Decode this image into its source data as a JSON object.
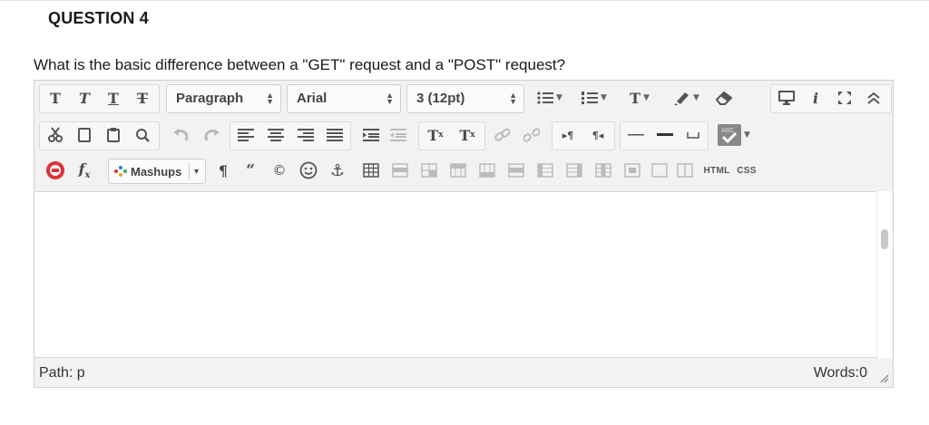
{
  "question": {
    "title": "QUESTION 4",
    "text": "What is the basic difference between a \"GET\" request and a \"POST\" request?"
  },
  "toolbar": {
    "paragraph_select": "Paragraph",
    "font_select": "Arial",
    "size_select": "3 (12pt)",
    "mashups_label": "Mashups",
    "html_label": "HTML",
    "css_label": "CSS",
    "bold_glyph": "T",
    "italic_glyph": "T",
    "underline_glyph": "T",
    "strike_glyph": "T",
    "text_color_glyph": "T",
    "superscript_glyph": "T",
    "subscript_glyph": "T",
    "info_glyph": "i"
  },
  "status": {
    "path_label": "Path: p",
    "words_label": "Words:0"
  },
  "colors": {
    "mashup_red": "#e0303a",
    "toolbar_bg": "#f2f2f2",
    "border": "#d0d0d0"
  }
}
